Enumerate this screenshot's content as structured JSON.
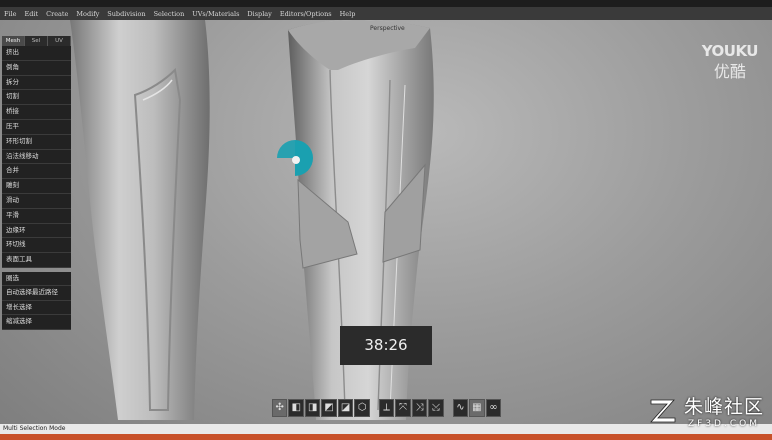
{
  "menu": [
    "File",
    "Edit",
    "Create",
    "Modify",
    "Subdivision",
    "Selection",
    "UVs/Materials",
    "Display",
    "Editors/Options",
    "Help"
  ],
  "panel": {
    "tabs": [
      "Mesh",
      "Sel",
      "UV"
    ],
    "tools": [
      "挤出",
      "倒角",
      "拆分",
      "切割",
      "桥接",
      "压平",
      "环形切割",
      "沿法线移动",
      "合并",
      "雕刻",
      "滑动",
      "平滑",
      "边缘环",
      "环切线",
      "表面工具"
    ],
    "tools2": [
      "圈选",
      "自动选择最近路径",
      "增长选择",
      "缩减选择"
    ]
  },
  "viewport": {
    "label": "Perspective"
  },
  "video": {
    "timestamp": "38:26"
  },
  "logo": {
    "line1": "YOUKU",
    "line2": "优酷"
  },
  "watermark": {
    "line1": "朱峰社区",
    "line2": "ZF3D.COM"
  },
  "status": {
    "mode": "Multi Selection Mode"
  },
  "shelf": {
    "icons": [
      "select-icon",
      "cube-icon",
      "cube-icon",
      "cube-icon",
      "cube-icon",
      "box-icon",
      "move-icon",
      "rotate-icon",
      "scale-icon",
      "extend-icon",
      "curve-icon",
      "grid-icon",
      "link-icon"
    ]
  },
  "colors": {
    "gizmo": "#1aa0b0",
    "status_bar": "#e9e9e9",
    "accent": "#c8512a"
  }
}
